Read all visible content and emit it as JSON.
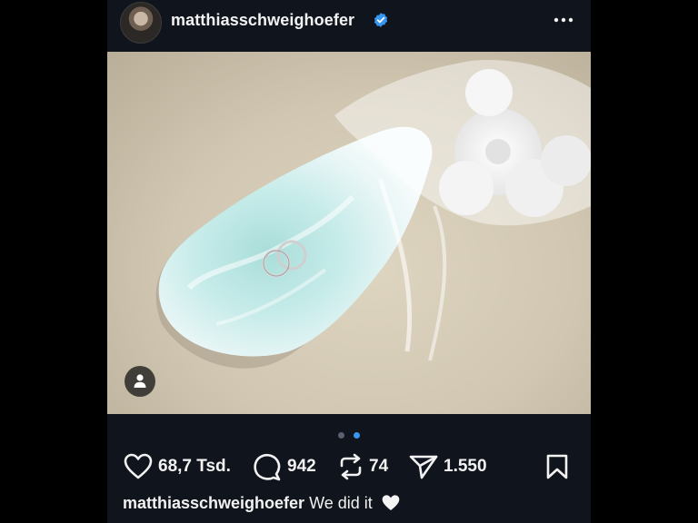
{
  "post": {
    "username": "matthiasschweighoefer",
    "verified": true,
    "avatar_icon": "profile-photo",
    "more_icon": "more-dots-icon",
    "carousel": {
      "total": 2,
      "active_index": 2
    },
    "tag_icon": "person-icon"
  },
  "actions": {
    "likes": "68,7 Tsd.",
    "comments": "942",
    "reposts": "74",
    "shares": "1.550"
  },
  "caption": {
    "username": "matthiasschweighoefer",
    "text": "We did it",
    "emoji": "white-heart"
  },
  "colors": {
    "background": "#10141c",
    "verified_blue": "#3797f0",
    "active_dot": "#3797f0"
  }
}
